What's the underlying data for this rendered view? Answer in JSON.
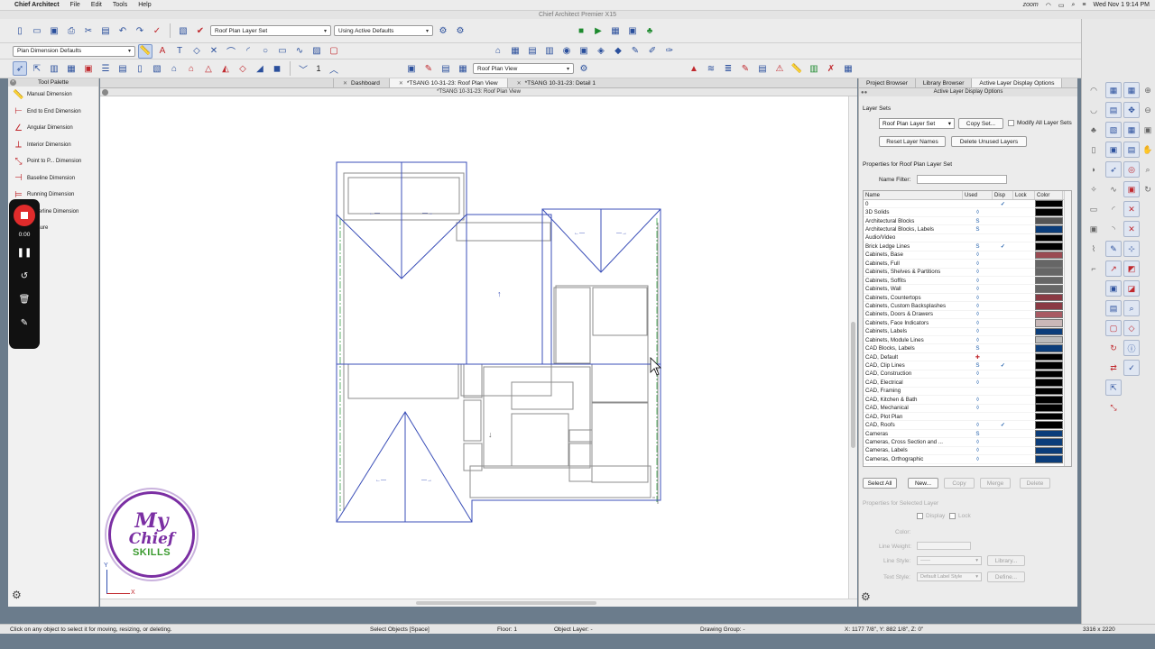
{
  "menubar": {
    "app_name": "Chief Architect",
    "items": [
      "File",
      "Edit",
      "Tools",
      "Help"
    ],
    "zoom_label": "zoom",
    "datetime": "Wed Nov 1  9:14 PM"
  },
  "window_title": "Chief Architect Premier X15",
  "toolbar1": {
    "layer_set": "Roof Plan Layer Set",
    "defaults": "Using Active Defaults"
  },
  "toolbar2": {
    "dimension_defaults": "Plan Dimension Defaults"
  },
  "toolbar3": {
    "floor_value": "1",
    "view_select": "Roof Plan View"
  },
  "tool_palette": {
    "title": "Tool Palette",
    "items": [
      {
        "label": "Manual Dimension",
        "icon": "ruler-icon"
      },
      {
        "label": "End to End Dimension",
        "icon": "end-to-end-icon"
      },
      {
        "label": "Angular Dimension",
        "icon": "angle-icon"
      },
      {
        "label": "Interior Dimension",
        "icon": "interior-dimension-icon"
      },
      {
        "label": "Point to P... Dimension",
        "icon": "point-dimension-icon"
      },
      {
        "label": "Baseline Dimension",
        "icon": "baseline-icon"
      },
      {
        "label": "Running Dimension",
        "icon": "running-icon"
      },
      {
        "label": "Centerline Dimension",
        "icon": "centerline-icon"
      },
      {
        "label": "Measure",
        "icon": "measure-icon"
      }
    ]
  },
  "recorder": {
    "time": "0:00"
  },
  "doc_tabs": [
    {
      "label": "Dashboard",
      "active": false
    },
    {
      "label": "*TSANG 10-31-23: Roof Plan View",
      "active": true
    },
    {
      "label": "*TSANG 10-31-23: Detail 1",
      "active": false
    }
  ],
  "canvas_title": "*TSANG 10-31-23: Roof Plan View",
  "logo": {
    "line1": "My",
    "line2": "Chief",
    "line3": "SKILLS"
  },
  "axis": {
    "x": "X",
    "y": "Y"
  },
  "side_panel": {
    "tabs": [
      {
        "label": "Project Browser",
        "active": false
      },
      {
        "label": "Library Browser",
        "active": false
      },
      {
        "label": "Active Layer Display Options",
        "active": true
      }
    ],
    "title": "Active Layer Display Options",
    "layer_sets_label": "Layer Sets",
    "layer_set_value": "Roof Plan Layer Set",
    "copy_set": "Copy Set...",
    "modify_all": "Modify All Layer Sets",
    "reset_names": "Reset Layer Names",
    "delete_unused": "Delete Unused Layers",
    "properties_for": "Properties for Roof Plan Layer Set",
    "name_filter_label": "Name Filter:",
    "columns": [
      "Name",
      "Used",
      "Disp",
      "Lock",
      "Color"
    ],
    "layers": [
      {
        "name": "0",
        "used": "",
        "disp": "✓",
        "color": "#000000"
      },
      {
        "name": "3D Solids",
        "used": "◊",
        "disp": "",
        "color": "#000000"
      },
      {
        "name": "Architectural Blocks",
        "used": "S",
        "disp": "",
        "color": "#555555"
      },
      {
        "name": "Architectural Blocks, Labels",
        "used": "S",
        "disp": "",
        "color": "#0b3d7a"
      },
      {
        "name": "Audio/Video",
        "used": "",
        "disp": "",
        "color": "#000000"
      },
      {
        "name": "Brick Ledge Lines",
        "used": "S",
        "disp": "✓",
        "color": "#000000"
      },
      {
        "name": "Cabinets,  Base",
        "used": "◊",
        "disp": "",
        "color": "#9a4a52"
      },
      {
        "name": "Cabinets,  Full",
        "used": "◊",
        "disp": "",
        "color": "#666666"
      },
      {
        "name": "Cabinets,  Shelves & Partitions",
        "used": "◊",
        "disp": "",
        "color": "#666666"
      },
      {
        "name": "Cabinets,  Soffits",
        "used": "◊",
        "disp": "",
        "color": "#666666"
      },
      {
        "name": "Cabinets,  Wall",
        "used": "◊",
        "disp": "",
        "color": "#666666"
      },
      {
        "name": "Cabinets, Countertops",
        "used": "◊",
        "disp": "",
        "color": "#8a3a44"
      },
      {
        "name": "Cabinets, Custom Backsplashes",
        "used": "◊",
        "disp": "",
        "color": "#8a3a44"
      },
      {
        "name": "Cabinets, Doors & Drawers",
        "used": "◊",
        "disp": "",
        "color": "#a85a63"
      },
      {
        "name": "Cabinets, Face Indicators",
        "used": "◊",
        "disp": "",
        "color": "#c9b8b8"
      },
      {
        "name": "Cabinets, Labels",
        "used": "◊",
        "disp": "",
        "color": "#0b3d7a"
      },
      {
        "name": "Cabinets, Module Lines",
        "used": "◊",
        "disp": "",
        "color": "#bbbbbb"
      },
      {
        "name": "CAD Blocks, Labels",
        "used": "S",
        "disp": "",
        "color": "#0b3d7a"
      },
      {
        "name": "CAD,  Default",
        "used": "✚",
        "disp": "",
        "color": "#000000"
      },
      {
        "name": "CAD, Clip Lines",
        "used": "S",
        "disp": "✓",
        "color": "#000000"
      },
      {
        "name": "CAD, Construction",
        "used": "◊",
        "disp": "",
        "color": "#000000"
      },
      {
        "name": "CAD, Electrical",
        "used": "◊",
        "disp": "",
        "color": "#000000"
      },
      {
        "name": "CAD, Framing",
        "used": "",
        "disp": "",
        "color": "#000000"
      },
      {
        "name": "CAD, Kitchen & Bath",
        "used": "◊",
        "disp": "",
        "color": "#000000"
      },
      {
        "name": "CAD, Mechanical",
        "used": "◊",
        "disp": "",
        "color": "#000000"
      },
      {
        "name": "CAD, Plot Plan",
        "used": "",
        "disp": "",
        "color": "#000000"
      },
      {
        "name": "CAD, Roofs",
        "used": "◊",
        "disp": "✓",
        "color": "#000000"
      },
      {
        "name": "Cameras",
        "used": "S",
        "disp": "",
        "color": "#0b3d7a"
      },
      {
        "name": "Cameras, Cross Section and ...",
        "used": "◊",
        "disp": "",
        "color": "#0b3d7a"
      },
      {
        "name": "Cameras, Labels",
        "used": "◊",
        "disp": "",
        "color": "#0b3d7a"
      },
      {
        "name": "Cameras, Orthographic",
        "used": "◊",
        "disp": "",
        "color": "#0b3d7a"
      }
    ],
    "buttons": {
      "select_all": "Select All",
      "new": "New...",
      "copy": "Copy",
      "merge": "Merge",
      "delete": "Delete"
    },
    "props_selected": "Properties for Selected Layer",
    "display": "Display",
    "lock": "Lock",
    "color": "Color:",
    "line_weight": "Line Weight:",
    "line_style": "Line Style:",
    "library": "Library...",
    "text_style": "Text Style:",
    "text_style_value": "Default Label Style",
    "define": "Define..."
  },
  "status": {
    "hint": "Click on any object to select it for moving, resizing, or deleting.",
    "mode": "Select Objects [Space]",
    "floor": "Floor: 1",
    "object_layer": "Object Layer: -",
    "drawing_group": "Drawing Group: -",
    "coords": "X: 1177 7/8\", Y: 882 1/8\", Z: 0\"",
    "size": "3316 x 2220"
  },
  "colors": {
    "roof_line": "#3b4fb8",
    "wall_line": "#8a8a8a",
    "record": "#e02b2b",
    "brand_purple": "#7b2fa3",
    "brand_green": "#3a9a2e"
  }
}
